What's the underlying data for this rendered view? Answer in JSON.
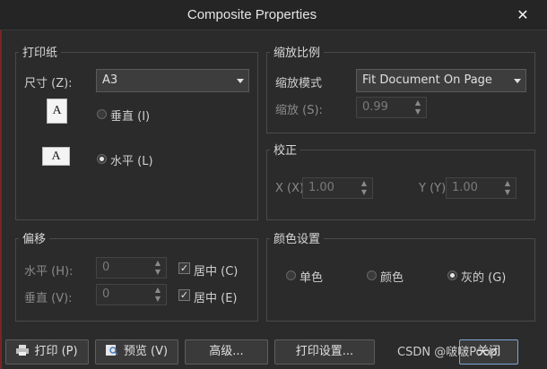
{
  "window": {
    "title": "Composite Properties",
    "close_glyph": "✕"
  },
  "paper": {
    "title": "打印纸",
    "size_label": "尺寸 (Z):",
    "size_value": "A3",
    "portrait_label": "垂直 (I)",
    "landscape_label": "水平 (L)",
    "portrait_icon_letter": "A",
    "landscape_icon_letter": "A",
    "orientation": "landscape"
  },
  "scale": {
    "title": "缩放比例",
    "mode_label": "缩放模式",
    "mode_value": "Fit Document On Page",
    "scale_label": "缩放 (S):",
    "scale_value": "0.99"
  },
  "correction": {
    "title": "校正",
    "x_label": "X (X)",
    "x_value": "1.00",
    "y_label": "Y (Y)",
    "y_value": "1.00"
  },
  "offset": {
    "title": "偏移",
    "h_label": "水平 (H):",
    "h_value": "0",
    "h_center_label": "居中 (C)",
    "v_label": "垂直 (V):",
    "v_value": "0",
    "v_center_label": "居中 (E)"
  },
  "color": {
    "title": "颜色设置",
    "mono_label": "单色",
    "color_label": "颜色",
    "gray_label": "灰的 (G)",
    "selected": "gray"
  },
  "buttons": {
    "print": "打印 (P)",
    "preview": "预览 (V)",
    "advanced": "高级...",
    "print_setup": "打印设置...",
    "close_partial": "关闭"
  },
  "watermark": "CSDN @啵啵Poopl"
}
